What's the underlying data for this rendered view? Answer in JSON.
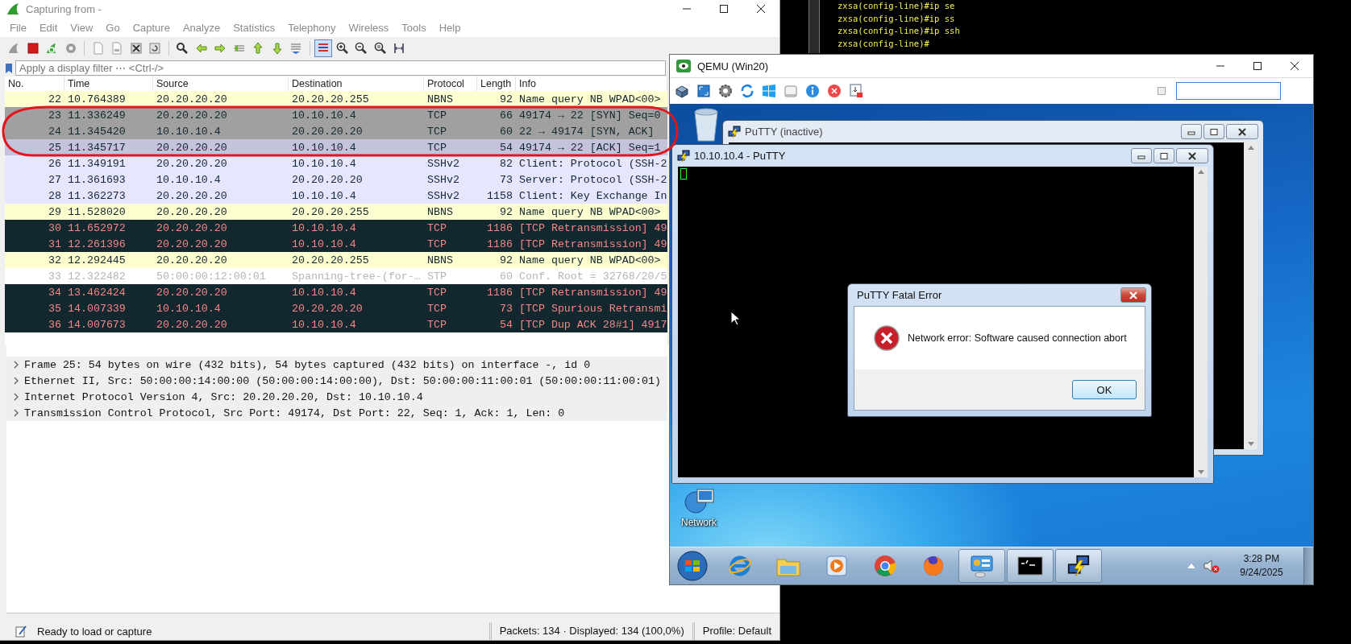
{
  "wireshark": {
    "title": "Capturing from -",
    "menu": [
      "File",
      "Edit",
      "View",
      "Go",
      "Capture",
      "Analyze",
      "Statistics",
      "Telephony",
      "Wireless",
      "Tools",
      "Help"
    ],
    "toolbar": {
      "colorize": {
        "on": true
      }
    },
    "filter": {
      "placeholder": "Apply a display filter ⋯ <Ctrl-/>"
    },
    "columns": [
      "No.",
      "Time",
      "Source",
      "Destination",
      "Protocol",
      "Length",
      "Info"
    ],
    "packets": [
      {
        "no": "22",
        "time": "10.764389",
        "source": "20.20.20.20",
        "destination": "20.20.20.255",
        "protocol": "NBNS",
        "length": "92",
        "info": "Name query NB WPAD<00>",
        "kind": "nbns",
        "selected": false
      },
      {
        "no": "23",
        "time": "11.336249",
        "source": "20.20.20.20",
        "destination": "10.10.10.4",
        "protocol": "TCP",
        "length": "66",
        "info": "49174 → 22 [SYN] Seq=0",
        "kind": "syn",
        "selected": false
      },
      {
        "no": "24",
        "time": "11.345420",
        "source": "10.10.10.4",
        "destination": "20.20.20.20",
        "protocol": "TCP",
        "length": "60",
        "info": "22 → 49174 [SYN, ACK]",
        "kind": "syn",
        "selected": false
      },
      {
        "no": "25",
        "time": "11.345717",
        "source": "20.20.20.20",
        "destination": "10.10.10.4",
        "protocol": "TCP",
        "length": "54",
        "info": "49174 → 22 [ACK] Seq=1",
        "kind": "tcp",
        "selected": true
      },
      {
        "no": "26",
        "time": "11.349191",
        "source": "20.20.20.20",
        "destination": "10.10.10.4",
        "protocol": "SSHv2",
        "length": "82",
        "info": "Client: Protocol (SSH-2",
        "kind": "tcp",
        "selected": false
      },
      {
        "no": "27",
        "time": "11.361693",
        "source": "10.10.10.4",
        "destination": "20.20.20.20",
        "protocol": "SSHv2",
        "length": "73",
        "info": "Server: Protocol (SSH-2",
        "kind": "tcp",
        "selected": false
      },
      {
        "no": "28",
        "time": "11.362273",
        "source": "20.20.20.20",
        "destination": "10.10.10.4",
        "protocol": "SSHv2",
        "length": "1158",
        "info": "Client: Key Exchange In",
        "kind": "tcp",
        "selected": false
      },
      {
        "no": "29",
        "time": "11.528020",
        "source": "20.20.20.20",
        "destination": "20.20.20.255",
        "protocol": "NBNS",
        "length": "92",
        "info": "Name query NB WPAD<00>",
        "kind": "nbns",
        "selected": false
      },
      {
        "no": "30",
        "time": "11.652972",
        "source": "20.20.20.20",
        "destination": "10.10.10.4",
        "protocol": "TCP",
        "length": "1186",
        "info": "[TCP Retransmission] 49",
        "kind": "bad",
        "selected": false
      },
      {
        "no": "31",
        "time": "12.261396",
        "source": "20.20.20.20",
        "destination": "10.10.10.4",
        "protocol": "TCP",
        "length": "1186",
        "info": "[TCP Retransmission] 49",
        "kind": "bad",
        "selected": false
      },
      {
        "no": "32",
        "time": "12.292445",
        "source": "20.20.20.20",
        "destination": "20.20.20.255",
        "protocol": "NBNS",
        "length": "92",
        "info": "Name query NB WPAD<00>",
        "kind": "nbns",
        "selected": false
      },
      {
        "no": "33",
        "time": "12.322482",
        "source": "50:00:00:12:00:01",
        "destination": "Spanning-tree-(for-…",
        "protocol": "STP",
        "length": "60",
        "info": "Conf. Root = 32768/20/5",
        "kind": "stp",
        "selected": false
      },
      {
        "no": "34",
        "time": "13.462424",
        "source": "20.20.20.20",
        "destination": "10.10.10.4",
        "protocol": "TCP",
        "length": "1186",
        "info": "[TCP Retransmission] 49",
        "kind": "bad",
        "selected": false
      },
      {
        "no": "35",
        "time": "14.007339",
        "source": "10.10.10.4",
        "destination": "20.20.20.20",
        "protocol": "TCP",
        "length": "73",
        "info": "[TCP Spurious Retransmi",
        "kind": "bad",
        "selected": false
      },
      {
        "no": "36",
        "time": "14.007673",
        "source": "20.20.20.20",
        "destination": "10.10.10.4",
        "protocol": "TCP",
        "length": "54",
        "info": "[TCP Dup ACK 28#1] 4917",
        "kind": "bad",
        "selected": false
      }
    ],
    "details": [
      {
        "text": "Frame 25: 54 bytes on wire (432 bits), 54 bytes captured (432 bits) on interface -, id 0",
        "expanded": false
      },
      {
        "text": "Ethernet II, Src: 50:00:00:14:00:00 (50:00:00:14:00:00), Dst: 50:00:00:11:00:01 (50:00:00:11:00:01)",
        "expanded": false
      },
      {
        "text": "Internet Protocol Version 4, Src: 20.20.20.20, Dst: 10.10.10.4",
        "expanded": false
      },
      {
        "text": "Transmission Control Protocol, Src Port: 49174, Dst Port: 22, Seq: 1, Ack: 1, Len: 0",
        "expanded": false
      }
    ],
    "status": {
      "message": "Ready to load or capture",
      "counts": "Packets: 134 · Displayed: 134 (100,0%)",
      "profile": "Profile: Default"
    }
  },
  "terminal": {
    "lines": [
      "zxsa(config-line)#ip se",
      "zxsa(config-line)#ip ss",
      "zxsa(config-line)#ip ssh",
      "zxsa(config-line)#"
    ]
  },
  "qemu": {
    "title": "QEMU (Win20)",
    "toolbar_checkbox": {
      "checked": false
    }
  },
  "desktop": {
    "icons": [
      {
        "kind": "recycle_bin"
      },
      {
        "kind": "network",
        "label": "Network"
      }
    ]
  },
  "putty_windows": [
    {
      "title": "PuTTY (inactive)",
      "active": false
    },
    {
      "title": "10.10.10.4 - PuTTY",
      "active": true
    }
  ],
  "error_dialog": {
    "title": "PuTTY Fatal Error",
    "message": "Network error: Software caused connection abort",
    "button": "OK"
  },
  "taskbar": {
    "apps": [
      {
        "kind": "ie",
        "running": false
      },
      {
        "kind": "folder",
        "running": false
      },
      {
        "kind": "media",
        "running": false
      },
      {
        "kind": "chrome",
        "running": false
      },
      {
        "kind": "firefox",
        "running": false
      },
      {
        "kind": "control",
        "running": true
      },
      {
        "kind": "cmd",
        "running": true
      },
      {
        "kind": "putty",
        "running": true
      }
    ],
    "time": "3:28 PM",
    "date": "9/24/2025"
  }
}
